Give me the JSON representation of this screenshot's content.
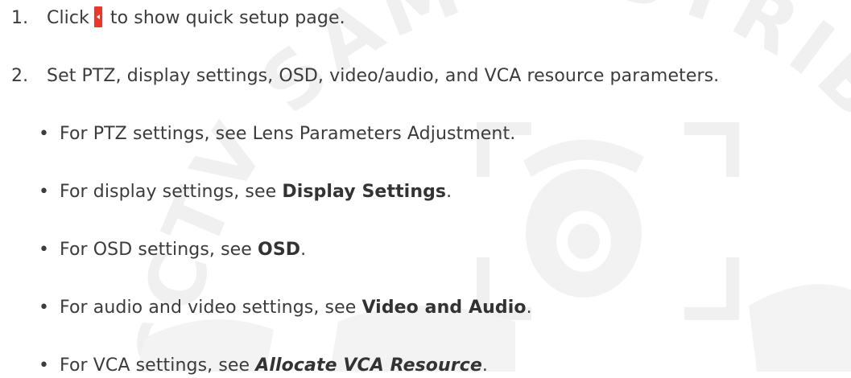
{
  "watermark": {
    "text": "CCTV SAM DISTRIBUTION",
    "color": "#ededed"
  },
  "steps": [
    {
      "number": "1.",
      "text_before": "Click",
      "icon": "quick-setup-arrow-icon",
      "text_after": "to show quick setup page."
    },
    {
      "number": "2.",
      "text": "Set PTZ, display settings, OSD, video/audio, and VCA resource parameters."
    }
  ],
  "bullets": [
    {
      "symbol": "•",
      "text": "For PTZ settings, see Lens Parameters Adjustment."
    },
    {
      "symbol": "•",
      "prefix": "For display settings, see ",
      "link": "Display Settings",
      "suffix": "."
    },
    {
      "symbol": "•",
      "prefix": "For OSD settings, see ",
      "link": "OSD",
      "suffix": "."
    },
    {
      "symbol": "•",
      "prefix": "For audio and video settings, see ",
      "link": "Video and Audio",
      "suffix": "."
    },
    {
      "symbol": "•",
      "prefix": "For VCA settings, see ",
      "link": "Allocate VCA Resource",
      "suffix": "."
    }
  ],
  "colors": {
    "text": "#3b3b3b",
    "icon_red": "#e8372c"
  }
}
